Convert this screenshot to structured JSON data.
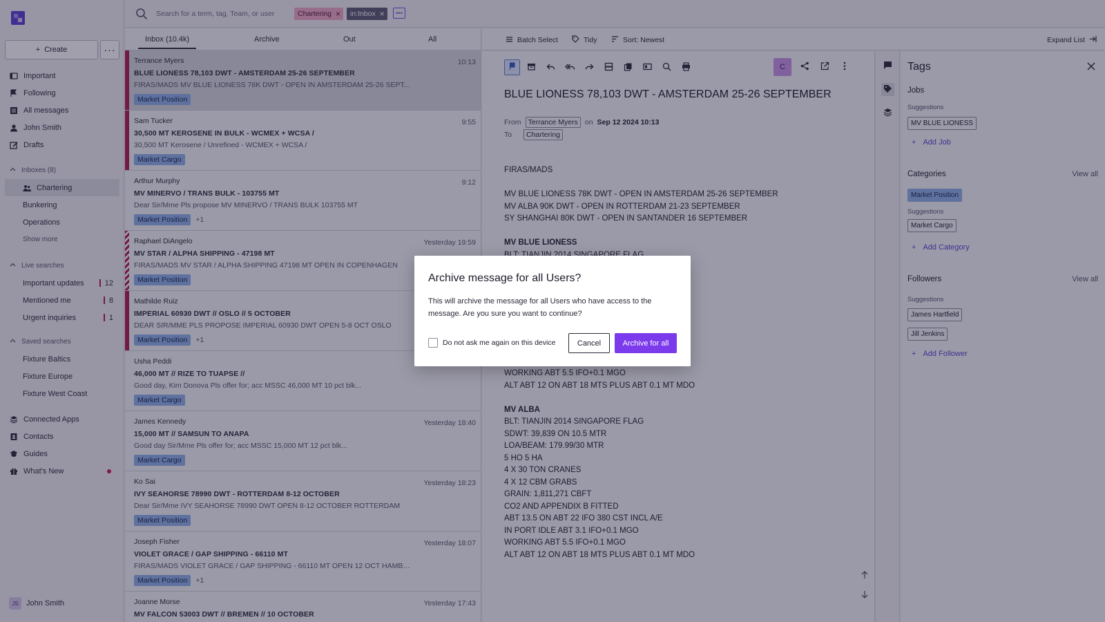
{
  "sidebar": {
    "create_label": "Create",
    "more_label": "···",
    "primary": [
      {
        "label": "Important",
        "icon": "important-icon"
      },
      {
        "label": "Following",
        "icon": "flag-icon"
      },
      {
        "label": "All messages",
        "icon": "list-icon"
      },
      {
        "label": "John Smith",
        "icon": "person-icon"
      },
      {
        "label": "Drafts",
        "icon": "drafts-icon"
      }
    ],
    "inboxes_title": "Inboxes (8)",
    "inboxes": [
      "Chartering",
      "Bunkering",
      "Operations"
    ],
    "show_more": "Show more",
    "live_title": "Live searches",
    "live": [
      {
        "label": "Important updates",
        "count": "12"
      },
      {
        "label": "Mentioned me",
        "count": "8"
      },
      {
        "label": "Urgent inquiries",
        "count": "1"
      }
    ],
    "saved_title": "Saved searches",
    "saved": [
      "Fixture Baltics",
      "Fixture Europe",
      "Fixture West Coast"
    ],
    "bottom": [
      {
        "label": "Connected Apps",
        "icon": "layers-icon"
      },
      {
        "label": "Contacts",
        "icon": "contacts-icon"
      },
      {
        "label": "Guides",
        "icon": "guides-icon"
      },
      {
        "label": "What's New",
        "icon": "gift-icon"
      }
    ],
    "user_initials": "JS",
    "user_name": "John Smith"
  },
  "search": {
    "placeholder": "Search for a term, tag, Team, or user",
    "chips": [
      "Chartering",
      "in:Inbox"
    ]
  },
  "list": {
    "tabs": [
      "Inbox (10.4k)",
      "Archive",
      "Out",
      "All"
    ],
    "messages": [
      {
        "sender": "Terrance Myers",
        "time": "10:13",
        "subject": "BLUE LIONESS  78,103 DWT - AMSTERDAM 25-26 SEPTEMBER",
        "preview": "FIRAS/MADS MV BLUE LIONESS 78K DWT - OPEN IN AMSTERDAM 25-26 SEPT...",
        "tag": "Market Position",
        "more": ""
      },
      {
        "sender": "Sam Tucker",
        "time": "9:55",
        "subject": "30,500 MT KEROSENE IN BULK - WCMEX + WCSA /",
        "preview": "30,500 MT Kerosene / Unrefined - WCMEX + WCSA /",
        "tag": "Market Cargo",
        "more": ""
      },
      {
        "sender": "Arthur Murphy",
        "time": "9:12",
        "subject": "MV MINERVO / TRANS BULK - 103755 MT",
        "preview": "Dear Sir/Mme Pls propose MV MINERVO / TRANS BULK 103755 MT",
        "tag": "Market Position",
        "more": "+1"
      },
      {
        "sender": "Raphael DiAngelo",
        "time": "Yesterday 19:59",
        "subject": "MV STAR / ALPHA SHIPPING - 47198 MT",
        "preview": "FIRAS/MADS MV STAR / ALPHA SHIPPING 47198 MT OPEN IN COPENHAGEN",
        "tag": "Market Position",
        "more": ""
      },
      {
        "sender": "Mathilde Ruiz",
        "time": "",
        "subject": "IMPERIAL 60930 DWT // OSLO // 5 OCTOBER",
        "preview": "DEAR SIR/MME PLS PROPOSE IMPERIAL 60930 DWT OPEN 5-8 OCT OSLO",
        "tag": "Market Position",
        "more": "+1"
      },
      {
        "sender": "Usha Peddi",
        "time": "",
        "subject": "46,000 MT // RIZE TO TUAPSE //",
        "preview": "Good day, Kim Donova Pls offer for; acc MSSC 46,000 MT 10 pct blk...",
        "tag": "Market Cargo",
        "more": ""
      },
      {
        "sender": "James Kennedy",
        "time": "Yesterday 18:40",
        "subject": "15,000 MT // SAMSUN TO ANAPA",
        "preview": "Good day Sir/Mme Pls offer for; acc MSSC 15,000 MT 12 pct blk...",
        "tag": "Market Cargo",
        "more": ""
      },
      {
        "sender": "Ko Sai",
        "time": "Yesterday 18:23",
        "subject": "IVY SEAHORSE 78990 DWT - ROTTERDAM 8-12 OCTOBER",
        "preview": "Dear Sir/Mme IVY SEAHORSE 78990 DWT OPEN 8-12 OCTOBER ROTTERDAM",
        "tag": "Market Position",
        "more": ""
      },
      {
        "sender": "Joseph Fisher",
        "time": "Yesterday 18:07",
        "subject": "VIOLET GRACE / GAP SHIPPING - 66110 MT",
        "preview": "FIRAS/MADS VIOLET GRACE / GAP SHIPPING - 66110 MT OPEN 12 OCT HAMBURG",
        "tag": "Market Position",
        "more": "+1"
      },
      {
        "sender": "Joanne Morse",
        "time": "Yesterday 17:43",
        "subject": "MV FALCON 53003 DWT // BREMEN // 10 OCTOBER",
        "preview": "",
        "tag": "",
        "more": ""
      }
    ]
  },
  "pane_head": {
    "batch": "Batch Select",
    "tidy": "Tidy",
    "sort": "Sort: Newest",
    "expand": "Expand List"
  },
  "reader": {
    "avatar": "C",
    "subject": "BLUE LIONESS 78,103 DWT - AMSTERDAM 25-26 SEPTEMBER",
    "from_label": "From",
    "from": "Terrance Myers",
    "on_label": "on",
    "date": "Sep 12 2024 10:13",
    "to_label": "To",
    "to": "Chartering",
    "body_top": [
      "FIRAS/MADS",
      "",
      "MV BLUE LIONESS  78K DWT - OPEN IN AMSTERDAM 25-26 SEPTEMBER",
      "MV ALBA 90K DWT - OPEN IN ROTTERDAM 21-23 SEPTEMBER",
      "SY SHANGHAI 80K DWT - OPEN IN SANTANDER 16 SEPTEMBER",
      "",
      "MV BLUE LIONESS",
      "BLT: TIANJIN 2014 SINGAPORE FLAG"
    ],
    "body_bottom": [
      "WORKING ABT 5.5 IFO+0.1 MGO",
      "ALT ABT 12 ON ABT 18 MTS PLUS ABT 0.1 MT MDO",
      "",
      "MV ALBA",
      "BLT: TIANJIN 2014 SINGAPORE FLAG",
      "SDWT: 39,839 ON 10.5 MTR",
      "LOA/BEAM: 179.99/30 MTR",
      "5 HO 5 HA",
      "4 X 30 TON CRANES",
      "4 X 12 CBM GRABS",
      "GRAIN: 1,811,271 CBFT",
      "CO2 AND APPENDIX B FITTED",
      "ABT 13.5 ON ABT 22 IFO 380 CST INCL A/E",
      "IN PORT IDLE ABT 3.1 IFO+0.1 MGO",
      "WORKING ABT 5.5 IFO+0.1 MGO",
      "ALT ABT 12 ON ABT 18 MTS PLUS ABT 0.1 MT MDO"
    ]
  },
  "tags_panel": {
    "title": "Tags",
    "jobs_title": "Jobs",
    "suggestions": "Suggestions",
    "job_suggestion": "MV BLUE LIONESS",
    "add_job": "Add Job",
    "categories_title": "Categories",
    "view_all": "View all",
    "category_selected": "Market Position",
    "category_suggestion": "Market Cargo",
    "add_category": "Add Category",
    "followers_title": "Followers",
    "follower_suggestions": [
      "James Hartfield",
      "Jill Jenkins"
    ],
    "add_follower": "Add Follower"
  },
  "modal": {
    "title": "Archive message for all Users?",
    "text": "This will archive the message for all Users who have access to the message. Are you sure you want to continue?",
    "checkbox_label": "Do not ask me again on this device",
    "cancel": "Cancel",
    "confirm": "Archive for all"
  },
  "colors": {
    "accent": "#7c3aed",
    "stripe": "#b3174f",
    "tag_blue": "#8fb0e8"
  }
}
